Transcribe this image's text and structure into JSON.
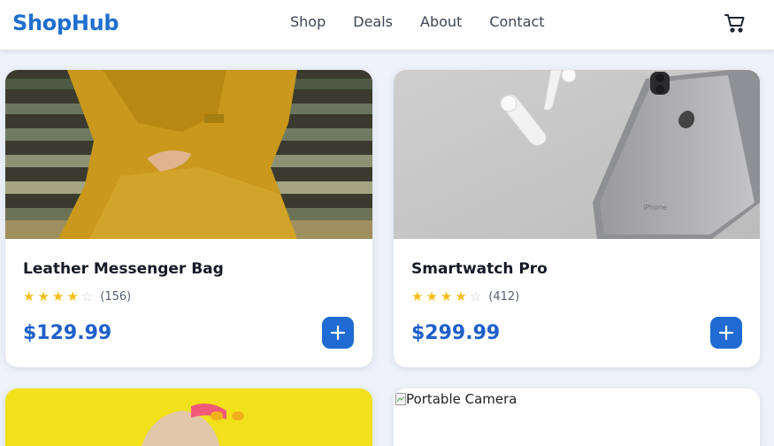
{
  "brand": {
    "name": "ShopHub",
    "accent": "#1f6fce"
  },
  "nav": {
    "items": [
      "Shop",
      "Deals",
      "About",
      "Contact"
    ]
  },
  "cart": {
    "icon": "shopping-cart-icon"
  },
  "products": [
    {
      "title": "Leather Messenger Bag",
      "rating": 4,
      "rating_count": "(156)",
      "price": "$129.99",
      "image": "woman-in-mustard-dress-photo"
    },
    {
      "title": "Smartwatch Pro",
      "rating": 4,
      "rating_count": "(412)",
      "price": "$299.99",
      "image": "iphone-and-airpods-photo"
    },
    {
      "image": "woman-with-yellow-sunglasses-photo"
    },
    {
      "image_alt": "Portable Camera"
    }
  ],
  "colors": {
    "star": "#f5be17",
    "price": "#1f5fc9",
    "add_button": "#1f6bd2"
  }
}
